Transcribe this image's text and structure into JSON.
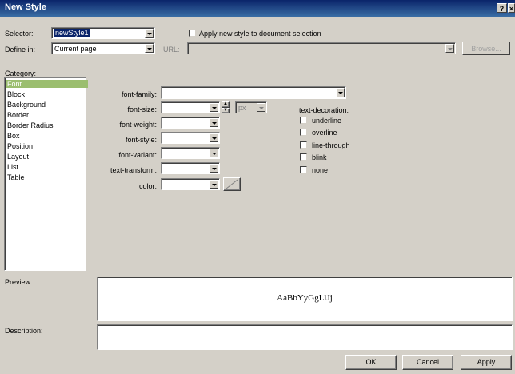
{
  "window": {
    "title": "New Style",
    "help_button": "?",
    "close_button": "×"
  },
  "selector": {
    "label": "Selector:",
    "value": "newStyle1"
  },
  "apply_checkbox": {
    "label": "Apply new style to document selection"
  },
  "define_in": {
    "label": "Define in:",
    "value": "Current page"
  },
  "url": {
    "label": "URL:",
    "value": "",
    "browse_label": "Browse..."
  },
  "category": {
    "label": "Category:",
    "items": [
      "Font",
      "Block",
      "Background",
      "Border",
      "Border Radius",
      "Box",
      "Position",
      "Layout",
      "List",
      "Table"
    ],
    "selected": "Font"
  },
  "font_fields": {
    "font_family": {
      "label": "font-family:",
      "value": ""
    },
    "font_size": {
      "label": "font-size:",
      "value": "",
      "unit": "px"
    },
    "font_weight": {
      "label": "font-weight:",
      "value": ""
    },
    "font_style": {
      "label": "font-style:",
      "value": ""
    },
    "font_variant": {
      "label": "font-variant:",
      "value": ""
    },
    "text_transform": {
      "label": "text-transform:",
      "value": ""
    },
    "color": {
      "label": "color:",
      "value": ""
    }
  },
  "text_decoration": {
    "label": "text-decoration:",
    "options": [
      "underline",
      "overline",
      "line-through",
      "blink",
      "none"
    ]
  },
  "preview": {
    "label": "Preview:",
    "sample": "AaBbYyGgLlJj"
  },
  "description": {
    "label": "Description:",
    "value": ""
  },
  "buttons": {
    "ok": "OK",
    "cancel": "Cancel",
    "apply": "Apply"
  },
  "colors": {
    "title_start": "#0a246a",
    "title_end": "#3a6ea5",
    "dialog_bg": "#d4d0c8",
    "selection": "#9bbe6f"
  }
}
